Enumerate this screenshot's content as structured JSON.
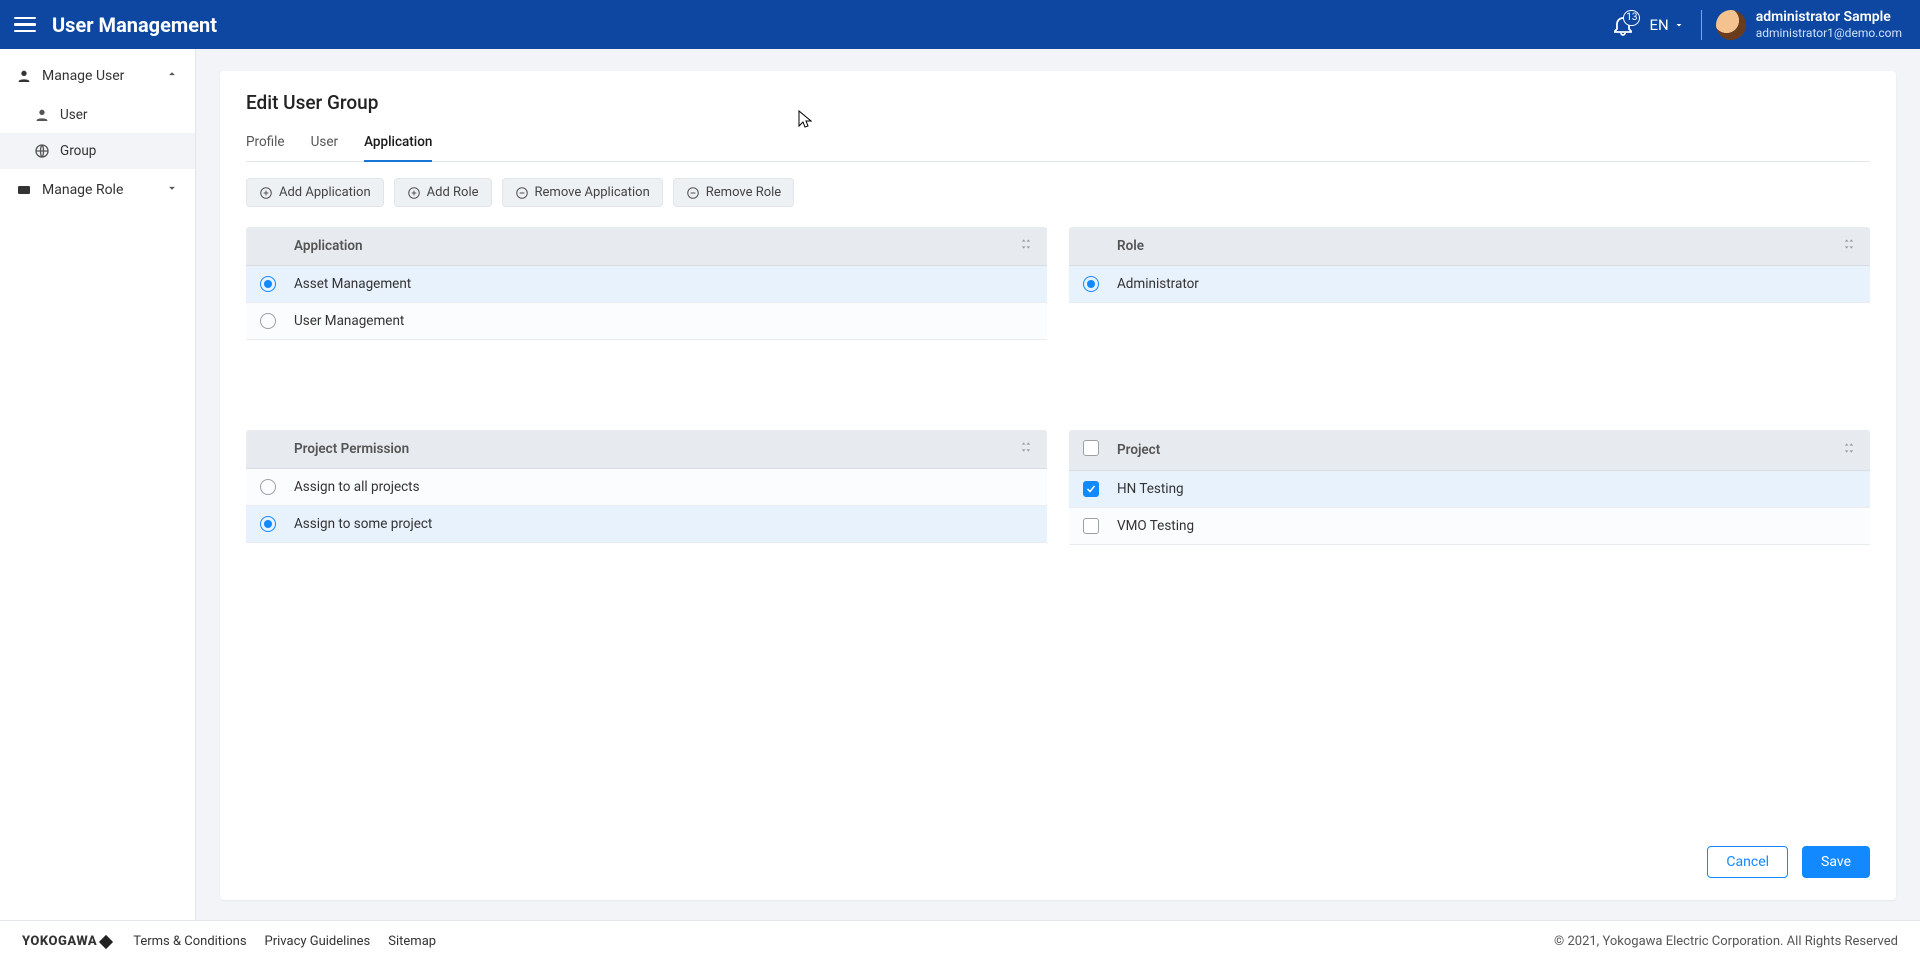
{
  "header": {
    "title": "User Management",
    "notif_count": "13",
    "language": "EN",
    "user_name": "administrator Sample",
    "user_email": "administrator1@demo.com"
  },
  "sidebar": {
    "manage_user": {
      "label": "Manage User",
      "expanded": true
    },
    "items": [
      {
        "label": "User",
        "active": false
      },
      {
        "label": "Group",
        "active": true
      }
    ],
    "manage_role": {
      "label": "Manage Role",
      "expanded": false
    }
  },
  "page": {
    "title": "Edit User Group",
    "tabs": [
      {
        "label": "Profile",
        "active": false
      },
      {
        "label": "User",
        "active": false
      },
      {
        "label": "Application",
        "active": true
      }
    ],
    "toolbar": {
      "add_application": "Add Application",
      "add_role": "Add Role",
      "remove_application": "Remove Application",
      "remove_role": "Remove Role"
    },
    "application_panel": {
      "header": "Application",
      "rows": [
        {
          "label": "Asset Management",
          "selected": true
        },
        {
          "label": "User Management",
          "selected": false
        }
      ]
    },
    "role_panel": {
      "header": "Role",
      "rows": [
        {
          "label": "Administrator",
          "selected": true
        }
      ]
    },
    "permission_panel": {
      "header": "Project Permission",
      "rows": [
        {
          "label": "Assign to all projects",
          "selected": false
        },
        {
          "label": "Assign to some project",
          "selected": true
        }
      ]
    },
    "project_panel": {
      "header": "Project",
      "rows": [
        {
          "label": "HN Testing",
          "checked": true
        },
        {
          "label": "VMO Testing",
          "checked": false
        }
      ]
    },
    "buttons": {
      "cancel": "Cancel",
      "save": "Save"
    }
  },
  "footer": {
    "brand": "YOKOGAWA",
    "links": [
      "Terms & Conditions",
      "Privacy Guidelines",
      "Sitemap"
    ],
    "copyright": "© 2021, Yokogawa Electric Corporation. All Rights Reserved"
  }
}
